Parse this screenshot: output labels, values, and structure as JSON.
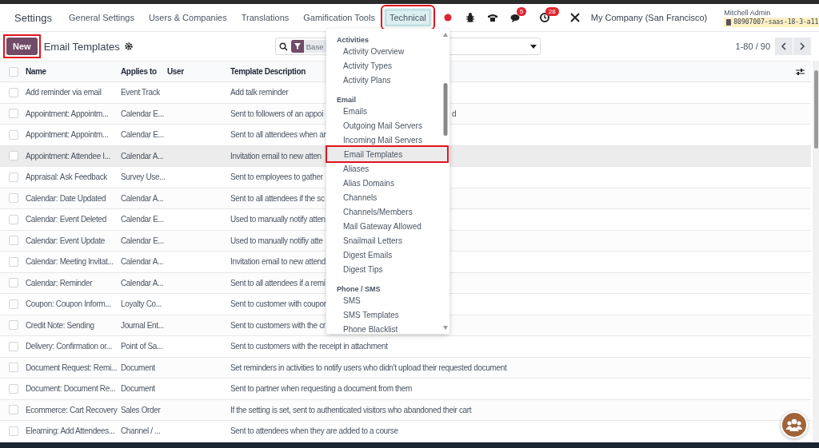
{
  "navbar": {
    "app_name": "Settings",
    "menu": [
      {
        "label": "General Settings",
        "selected": false,
        "annotated": false
      },
      {
        "label": "Users & Companies",
        "selected": false,
        "annotated": false
      },
      {
        "label": "Translations",
        "selected": false,
        "annotated": false
      },
      {
        "label": "Gamification Tools",
        "selected": false,
        "annotated": false
      },
      {
        "label": "Technical",
        "selected": true,
        "annotated": true
      }
    ],
    "messages_badge": "5",
    "activities_badge": "28",
    "company": "My Company (San Francisco)",
    "user": {
      "name": "Mitchell Admin",
      "database": "80907007-saas-18-3-a11"
    }
  },
  "control_panel": {
    "new_button": {
      "label": "New",
      "annotated": true
    },
    "title": "Email Templates",
    "search": {
      "facet": "Base"
    },
    "pager": "1-80 / 90"
  },
  "table": {
    "all_selected": false,
    "columns": [
      "Name",
      "Applies to",
      "User",
      "Template Description"
    ],
    "rows": [
      {
        "name": "Add reminder via email",
        "applies_to": "Event Track",
        "description": "Add talk reminder",
        "checked": false,
        "highlighted": false
      },
      {
        "name": "Appointment: Appointm...",
        "applies_to": "Calendar E...",
        "description": "Sent to followers of an appoi",
        "description_end": "d",
        "checked": false,
        "highlighted": false
      },
      {
        "name": "Appointment: Appointm...",
        "applies_to": "Calendar E...",
        "description": "Sent to all attendees when an",
        "checked": false,
        "highlighted": false
      },
      {
        "name": "Appointment: Attendee I...",
        "applies_to": "Calendar A...",
        "description": "Invitation email to new atten",
        "checked": false,
        "highlighted": true
      },
      {
        "name": "Appraisal: Ask Feedback",
        "applies_to": "Survey Use...",
        "description": "Sent to employees to gather",
        "checked": false,
        "highlighted": false
      },
      {
        "name": "Calendar: Date Updated",
        "applies_to": "Calendar A...",
        "description": "Sent to all attendees if the sc",
        "checked": false,
        "highlighted": false
      },
      {
        "name": "Calendar: Event Deleted",
        "applies_to": "Calendar E...",
        "description": "Used to manually notify atten",
        "checked": false,
        "highlighted": false
      },
      {
        "name": "Calendar: Event Update",
        "applies_to": "Calendar E...",
        "description": "Used to manually notifiy atte",
        "checked": false,
        "highlighted": false
      },
      {
        "name": "Calendar: Meeting Invitat...",
        "applies_to": "Calendar A...",
        "description": "Invitation email to new attend",
        "checked": false,
        "highlighted": false
      },
      {
        "name": "Calendar: Reminder",
        "applies_to": "Calendar A...",
        "description": "Sent to all attendees if a remi",
        "checked": false,
        "highlighted": false
      },
      {
        "name": "Coupon: Coupon Inform...",
        "applies_to": "Loyalty Co...",
        "description": "Sent to customer with coupon",
        "checked": false,
        "highlighted": false
      },
      {
        "name": "Credit Note: Sending",
        "applies_to": "Journal Ent...",
        "description": "Sent to customers with the cr",
        "checked": false,
        "highlighted": false
      },
      {
        "name": "Delivery: Confirmation or...",
        "applies_to": "Point of Sa...",
        "description": "Sent to customers with the receipt in attachment",
        "checked": false,
        "highlighted": false
      },
      {
        "name": "Document Request: Remi...",
        "applies_to": "Document",
        "description": "Set reminders in activities to notify users who didn't upload their requested document",
        "checked": false,
        "highlighted": false
      },
      {
        "name": "Document: Document Re...",
        "applies_to": "Document",
        "description": "Sent to partner when requesting a document from them",
        "checked": false,
        "highlighted": false
      },
      {
        "name": "Ecommerce: Cart Recovery",
        "applies_to": "Sales Order",
        "description": "If the setting is set, sent to authenticated visitors who abandoned their cart",
        "checked": false,
        "highlighted": false
      },
      {
        "name": "Elearning: Add Attendees...",
        "applies_to": "Channel / ...",
        "description": "Sent to attendees when they are added to a course",
        "checked": false,
        "highlighted": false
      }
    ]
  },
  "dropdown": {
    "entries": [
      {
        "kind": "header",
        "label": "Activities"
      },
      {
        "kind": "item",
        "label": "Activity Overview",
        "selected": false,
        "annotated": false
      },
      {
        "kind": "item",
        "label": "Activity Types",
        "selected": false,
        "annotated": false
      },
      {
        "kind": "item",
        "label": "Activity Plans",
        "selected": false,
        "annotated": false
      },
      {
        "kind": "header",
        "label": "Email"
      },
      {
        "kind": "item",
        "label": "Emails",
        "selected": false,
        "annotated": false
      },
      {
        "kind": "item",
        "label": "Outgoing Mail Servers",
        "selected": false,
        "annotated": false
      },
      {
        "kind": "item",
        "label": "Incoming Mail Servers",
        "selected": false,
        "annotated": false
      },
      {
        "kind": "item",
        "label": "Email Templates",
        "selected": true,
        "annotated": true
      },
      {
        "kind": "item",
        "label": "Aliases",
        "selected": false,
        "annotated": false
      },
      {
        "kind": "item",
        "label": "Alias Domains",
        "selected": false,
        "annotated": false
      },
      {
        "kind": "item",
        "label": "Channels",
        "selected": false,
        "annotated": false
      },
      {
        "kind": "item",
        "label": "Channels/Members",
        "selected": false,
        "annotated": false
      },
      {
        "kind": "item",
        "label": "Mail Gateway Allowed",
        "selected": false,
        "annotated": false
      },
      {
        "kind": "item",
        "label": "Snailmail Letters",
        "selected": false,
        "annotated": false
      },
      {
        "kind": "item",
        "label": "Digest Emails",
        "selected": false,
        "annotated": false
      },
      {
        "kind": "item",
        "label": "Digest Tips",
        "selected": false,
        "annotated": false
      },
      {
        "kind": "header",
        "label": "Phone / SMS"
      },
      {
        "kind": "item",
        "label": "SMS",
        "selected": false,
        "annotated": false
      },
      {
        "kind": "item",
        "label": "SMS Templates",
        "selected": false,
        "annotated": false
      },
      {
        "kind": "item",
        "label": "Phone Blacklist",
        "selected": false,
        "annotated": false
      }
    ]
  }
}
